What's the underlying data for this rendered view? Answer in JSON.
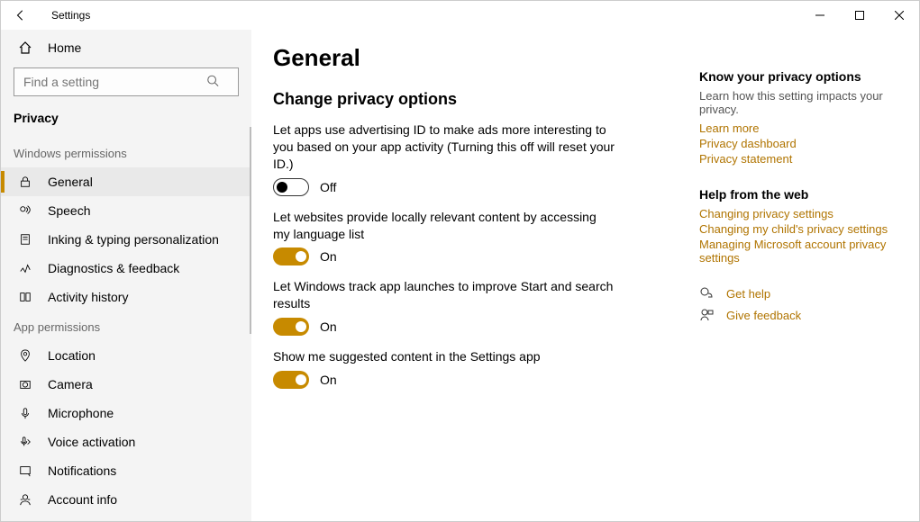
{
  "window": {
    "title": "Settings"
  },
  "sidebar": {
    "home": "Home",
    "search_placeholder": "Find a setting",
    "section": "Privacy",
    "group1_label": "Windows permissions",
    "group1": [
      {
        "label": "General"
      },
      {
        "label": "Speech"
      },
      {
        "label": "Inking & typing personalization"
      },
      {
        "label": "Diagnostics & feedback"
      },
      {
        "label": "Activity history"
      }
    ],
    "group2_label": "App permissions",
    "group2": [
      {
        "label": "Location"
      },
      {
        "label": "Camera"
      },
      {
        "label": "Microphone"
      },
      {
        "label": "Voice activation"
      },
      {
        "label": "Notifications"
      },
      {
        "label": "Account info"
      }
    ]
  },
  "main": {
    "h1": "General",
    "h2": "Change privacy options",
    "settings": [
      {
        "desc": "Let apps use advertising ID to make ads more interesting to you based on your app activity (Turning this off will reset your ID.)",
        "state_label": "Off",
        "on": false
      },
      {
        "desc": "Let websites provide locally relevant content by accessing my language list",
        "state_label": "On",
        "on": true
      },
      {
        "desc": "Let Windows track app launches to improve Start and search results",
        "state_label": "On",
        "on": true
      },
      {
        "desc": "Show me suggested content in the Settings app",
        "state_label": "On",
        "on": true
      }
    ]
  },
  "aside": {
    "know_h": "Know your privacy options",
    "know_p": "Learn how this setting impacts your privacy.",
    "know_links": [
      "Learn more",
      "Privacy dashboard",
      "Privacy statement"
    ],
    "help_h": "Help from the web",
    "help_links": [
      "Changing privacy settings",
      "Changing my child's privacy settings",
      "Managing Microsoft account privacy settings"
    ],
    "get_help": "Get help",
    "give_feedback": "Give feedback"
  }
}
